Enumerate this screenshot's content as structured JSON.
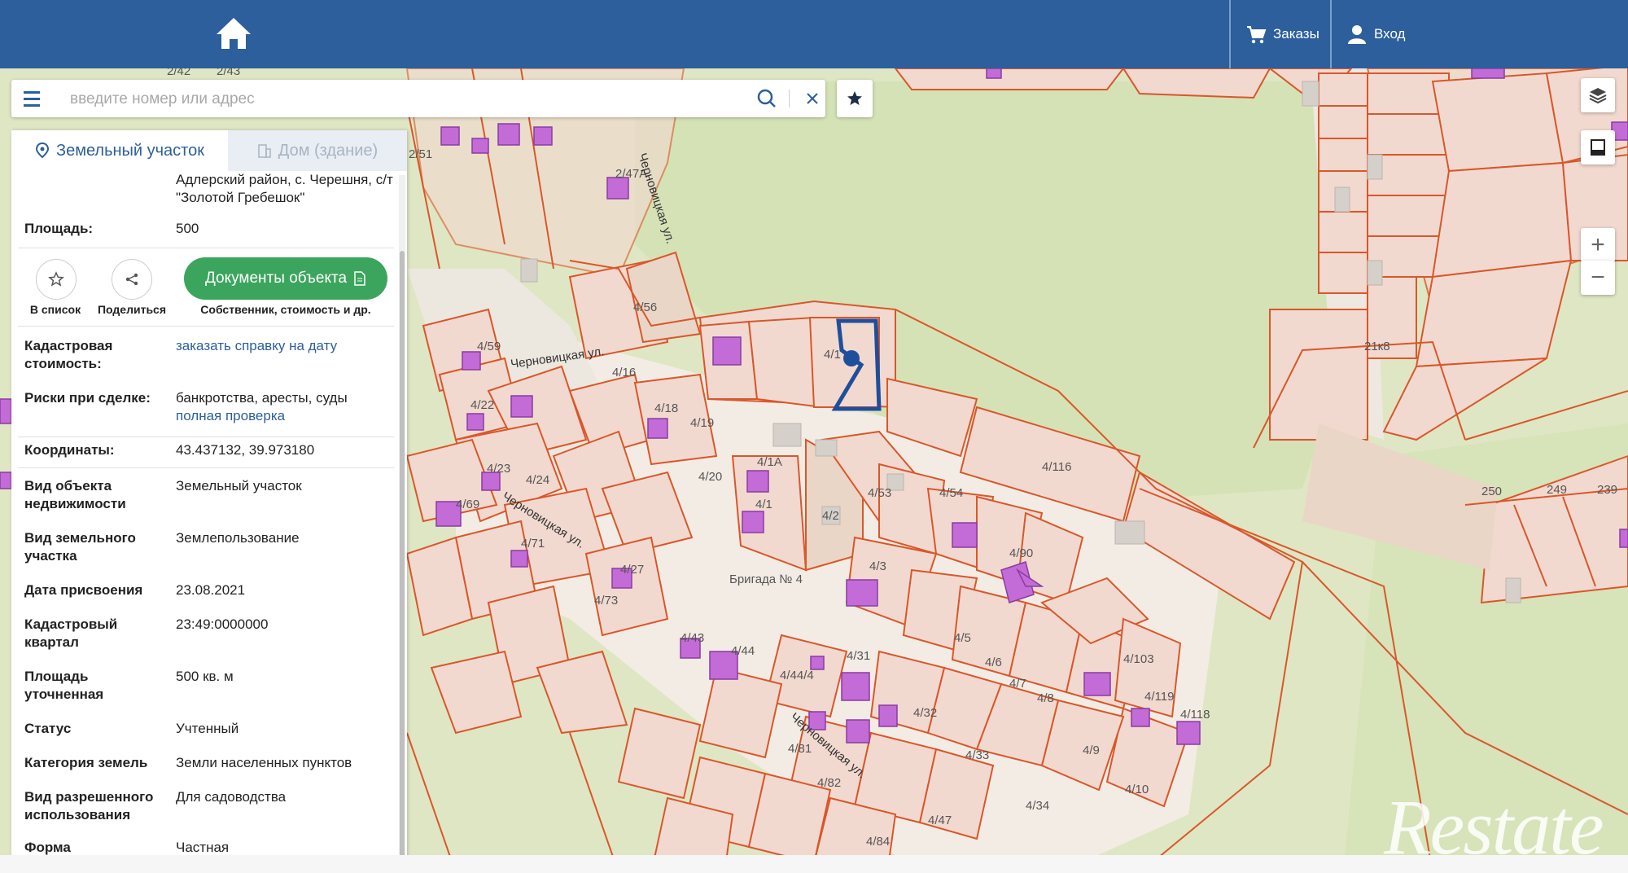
{
  "header": {
    "orders_label": "Заказы",
    "login_label": "Вход"
  },
  "search": {
    "placeholder": "введите номер или адрес"
  },
  "panel": {
    "tab_land": "Земельный участок",
    "tab_house": "Дом (здание)",
    "address": "Адлерский район, с. Черешня, с/т \"Золотой Гребешок\"",
    "area_label": "Площадь:",
    "area_value": "500",
    "actions": {
      "to_list": "В список",
      "share": "Поделиться",
      "documents_button": "Документы объекта",
      "documents_sub": "Собственник, стоимость и др."
    },
    "rows": [
      {
        "label": "Кадастровая стоимость:",
        "value": "заказать справку на дату"
      },
      {
        "label": "Риски при сделке:",
        "value": "банкротства, аресты, суды",
        "value2": "полная проверка"
      },
      {
        "label": "Координаты:",
        "value": "43.437132, 39.973180"
      },
      {
        "label": "Вид объекта недвижимости",
        "value": "Земельный участок"
      },
      {
        "label": "Вид земельного участка",
        "value": "Землепользование"
      },
      {
        "label": "Дата присвоения",
        "value": "23.08.2021"
      },
      {
        "label": "Кадастровый квартал",
        "value": "23:49:0000000"
      },
      {
        "label": "Площадь уточненная",
        "value": "500 кв. м"
      },
      {
        "label": "Статус",
        "value": "Учтенный"
      },
      {
        "label": "Категория земель",
        "value": "Земли населенных пунктов"
      },
      {
        "label": "Вид разрешенного использования",
        "value": "Для садоводства"
      },
      {
        "label": "Форма",
        "value": "Частная"
      }
    ]
  },
  "map": {
    "streets": [
      "Черновицкая ул.",
      "Черновицкая ул.",
      "Черновицкая ул.",
      "Черновицкая ул."
    ],
    "area_label": "Бригада № 4",
    "plots": [
      "2/42",
      "2/43",
      "2/51",
      "2/47А",
      "4/56",
      "4/59",
      "4/16",
      "4/22",
      "4/18",
      "4/19",
      "4/23",
      "4/24",
      "4/69",
      "4/20",
      "4/1А",
      "4/1",
      "4/2",
      "4/53",
      "4/54",
      "4/116",
      "4/3",
      "4/90",
      "4/71",
      "4/27",
      "4/73",
      "4/5",
      "4/6",
      "4/43",
      "4/44",
      "4/31",
      "4/7",
      "4/103",
      "4/8",
      "4/119",
      "4/118",
      "4/44/4",
      "4/32",
      "4/9",
      "4/81",
      "4/33",
      "4/10",
      "4/82",
      "4/34",
      "4/47",
      "4/84",
      "21к8",
      "250",
      "249",
      "239",
      "4/1"
    ],
    "watermark": "Restate"
  },
  "colors": {
    "header": "#2c5f9b",
    "accent_green": "#3ba55d",
    "plot_border": "#d9572b",
    "plot_fill": "#f2d9cf",
    "building": "#c36bd6",
    "selected": "#1f4f9a"
  }
}
